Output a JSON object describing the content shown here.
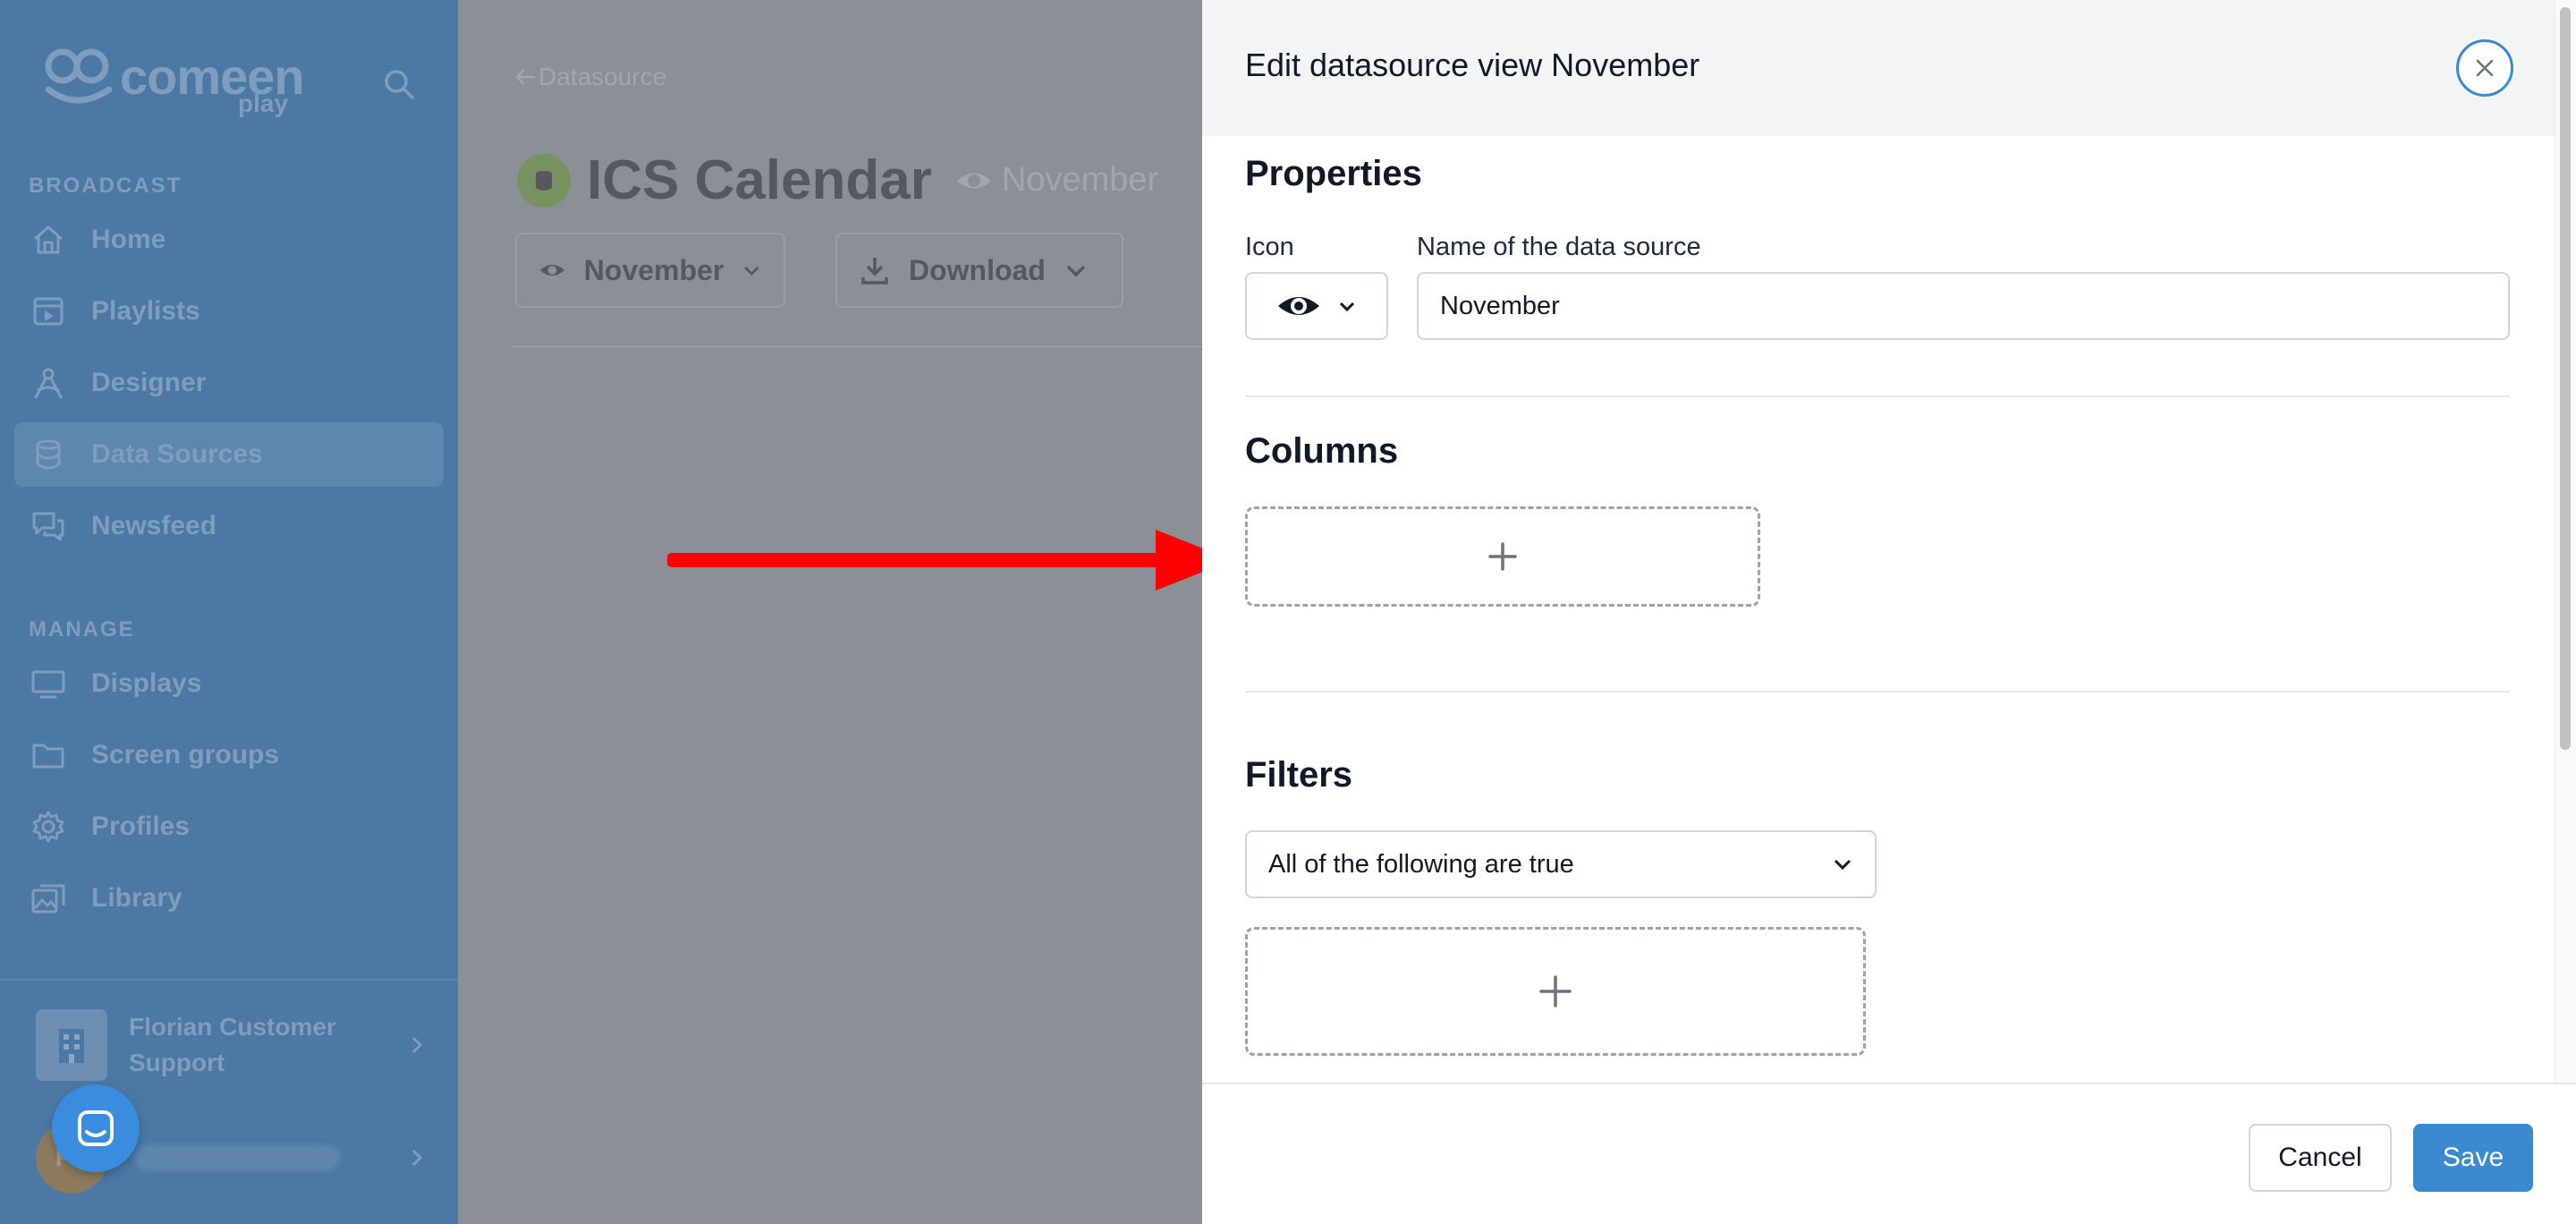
{
  "sidebar": {
    "logo_text": "comeen",
    "logo_subtext": "play",
    "sections": [
      {
        "title": "BROADCAST",
        "items": [
          {
            "label": "Home",
            "icon": "home-icon"
          },
          {
            "label": "Playlists",
            "icon": "playlist-icon"
          },
          {
            "label": "Designer",
            "icon": "designer-icon"
          },
          {
            "label": "Data Sources",
            "icon": "database-icon",
            "active": true
          },
          {
            "label": "Newsfeed",
            "icon": "chat-icon"
          }
        ]
      },
      {
        "title": "MANAGE",
        "items": [
          {
            "label": "Displays",
            "icon": "monitor-icon"
          },
          {
            "label": "Screen groups",
            "icon": "folder-icon"
          },
          {
            "label": "Profiles",
            "icon": "gear-icon"
          },
          {
            "label": "Library",
            "icon": "images-icon"
          }
        ]
      }
    ],
    "org_name": "Florian Customer Support",
    "user_initials": "FL"
  },
  "main": {
    "back_label": "Datasource",
    "title": "ICS Calendar",
    "view_name": "November",
    "view_button_label": "November",
    "download_button_label": "Download"
  },
  "panel": {
    "title": "Edit datasource view November",
    "properties_heading": "Properties",
    "icon_label": "Icon",
    "name_label": "Name of the data source",
    "name_value": "November",
    "columns_heading": "Columns",
    "filters_heading": "Filters",
    "filter_mode": "All of the following are true",
    "cancel_label": "Cancel",
    "save_label": "Save"
  },
  "colors": {
    "accent": "#3b8ad0",
    "sidebar_bg": "#4b79a4",
    "overlay": "#8b8f96",
    "arrow": "#ff0000"
  }
}
